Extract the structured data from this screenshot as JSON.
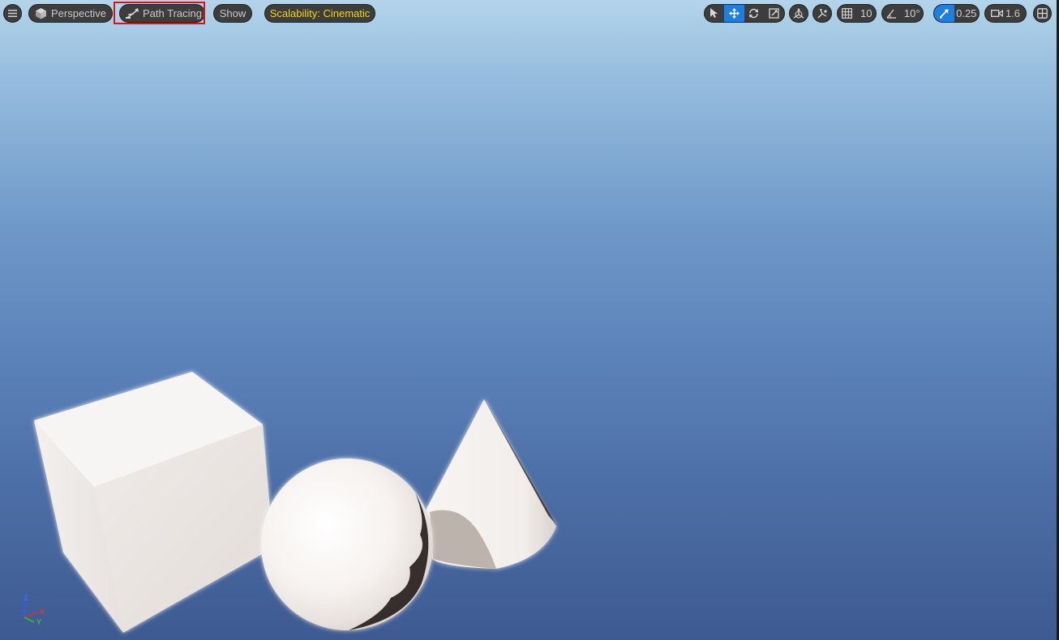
{
  "toolbar": {
    "menu_icon": "hamburger-menu-icon",
    "perspective_label": "Perspective",
    "viewmode_label": "Path Tracing",
    "show_label": "Show",
    "scalability_label": "Scalability: Cinematic",
    "scalability_color": "#f5d020",
    "grid_snap_value": "10",
    "rotation_snap_value": "10°",
    "scale_snap_value": "0.25",
    "camera_speed_value": "1.6",
    "active_tool": "translate",
    "accent_color": "#1f7fe0",
    "highlight_color": "#e01010"
  },
  "gizmo": {
    "z_label": "Z",
    "x_label": "X",
    "y_label": "Y"
  }
}
